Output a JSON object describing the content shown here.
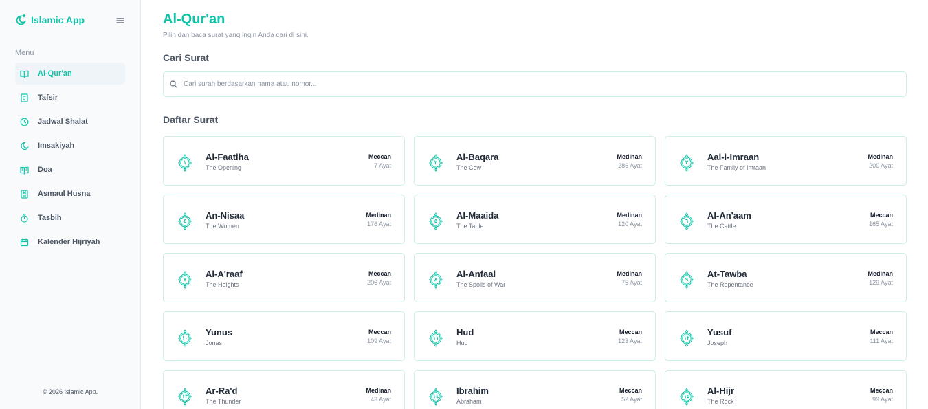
{
  "app": {
    "name": "Islamic App",
    "accent_color": "#10c4a8",
    "brand_icon": "moon-star-icon",
    "menu_toggle_icon": "hamburger-icon"
  },
  "sidebar": {
    "menu_heading": "Menu",
    "items": [
      {
        "label": "Al-Qur'an",
        "icon": "book-open-icon",
        "active": true
      },
      {
        "label": "Tafsir",
        "icon": "book-icon",
        "active": false
      },
      {
        "label": "Jadwal Shalat",
        "icon": "clock-icon",
        "active": false
      },
      {
        "label": "Imsakiyah",
        "icon": "moon-icon",
        "active": false
      },
      {
        "label": "Doa",
        "icon": "book-reader-icon",
        "active": false
      },
      {
        "label": "Asmaul Husna",
        "icon": "book-bookmark-icon",
        "active": false
      },
      {
        "label": "Tasbih",
        "icon": "timer-icon",
        "active": false
      },
      {
        "label": "Kalender Hijriyah",
        "icon": "calendar-icon",
        "active": false
      }
    ],
    "copyright": "© 2026 Islamic App."
  },
  "main": {
    "title": "Al-Qur'an",
    "subtitle": "Pilih dan baca surat yang ingin Anda cari di sini.",
    "search": {
      "heading": "Cari Surat",
      "placeholder": "Cari surah berdasarkan nama atau nomor...",
      "value": ""
    },
    "list_heading": "Daftar Surat",
    "surahs": [
      {
        "number": "١",
        "name": "Al-Faatiha",
        "meaning": "The Opening",
        "type": "Meccan",
        "ayat": "7 Ayat"
      },
      {
        "number": "٢",
        "name": "Al-Baqara",
        "meaning": "The Cow",
        "type": "Medinan",
        "ayat": "286 Ayat"
      },
      {
        "number": "٣",
        "name": "Aal-i-Imraan",
        "meaning": "The Family of Imraan",
        "type": "Medinan",
        "ayat": "200 Ayat"
      },
      {
        "number": "٤",
        "name": "An-Nisaa",
        "meaning": "The Women",
        "type": "Medinan",
        "ayat": "176 Ayat"
      },
      {
        "number": "٥",
        "name": "Al-Maaida",
        "meaning": "The Table",
        "type": "Medinan",
        "ayat": "120 Ayat"
      },
      {
        "number": "٦",
        "name": "Al-An'aam",
        "meaning": "The Cattle",
        "type": "Meccan",
        "ayat": "165 Ayat"
      },
      {
        "number": "٧",
        "name": "Al-A'raaf",
        "meaning": "The Heights",
        "type": "Meccan",
        "ayat": "206 Ayat"
      },
      {
        "number": "٨",
        "name": "Al-Anfaal",
        "meaning": "The Spoils of War",
        "type": "Medinan",
        "ayat": "75 Ayat"
      },
      {
        "number": "٩",
        "name": "At-Tawba",
        "meaning": "The Repentance",
        "type": "Medinan",
        "ayat": "129 Ayat"
      },
      {
        "number": "١٠",
        "name": "Yunus",
        "meaning": "Jonas",
        "type": "Meccan",
        "ayat": "109 Ayat"
      },
      {
        "number": "١١",
        "name": "Hud",
        "meaning": "Hud",
        "type": "Meccan",
        "ayat": "123 Ayat"
      },
      {
        "number": "١٢",
        "name": "Yusuf",
        "meaning": "Joseph",
        "type": "Meccan",
        "ayat": "111 Ayat"
      },
      {
        "number": "١٣",
        "name": "Ar-Ra'd",
        "meaning": "The Thunder",
        "type": "Medinan",
        "ayat": "43 Ayat"
      },
      {
        "number": "١٤",
        "name": "Ibrahim",
        "meaning": "Abraham",
        "type": "Meccan",
        "ayat": "52 Ayat"
      },
      {
        "number": "١٥",
        "name": "Al-Hijr",
        "meaning": "The Rock",
        "type": "Meccan",
        "ayat": "99 Ayat"
      }
    ]
  }
}
